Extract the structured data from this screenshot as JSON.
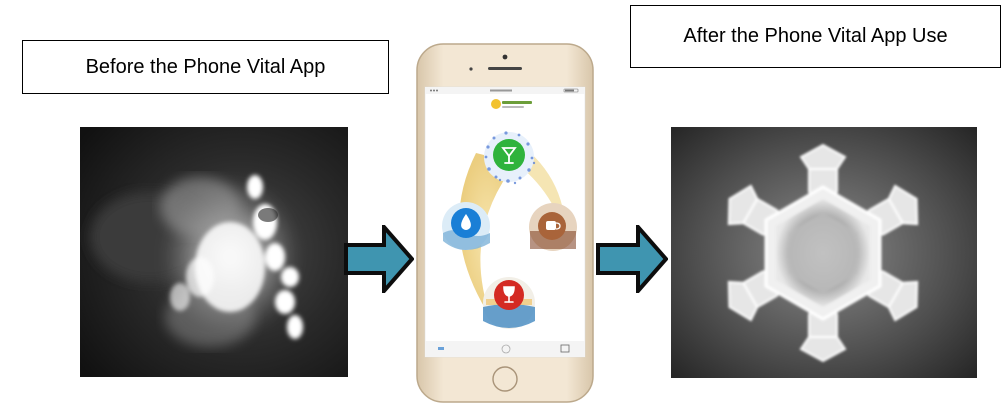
{
  "labels": {
    "before": "Before the Phone Vital App",
    "after": "After the Phone Vital App Use"
  },
  "icons": {
    "before_image": "water-crystal-image",
    "after_image": "water-crystal-image",
    "arrow": "right-arrow-icon",
    "phone": "smartphone-icon",
    "app_buttons": [
      "drink-icon",
      "water-drop-icon",
      "coffee-cup-icon",
      "wine-glass-icon"
    ]
  },
  "colors": {
    "arrow_fill": "#3f95b0",
    "arrow_border": "#0d0d0d",
    "phone_frame": "#eedfc9",
    "phone_screen": "#ffffff",
    "app_green": "#2fb33c",
    "app_blue": "#1a7fd6",
    "app_brown": "#a9643a",
    "app_red": "#d42a23"
  }
}
